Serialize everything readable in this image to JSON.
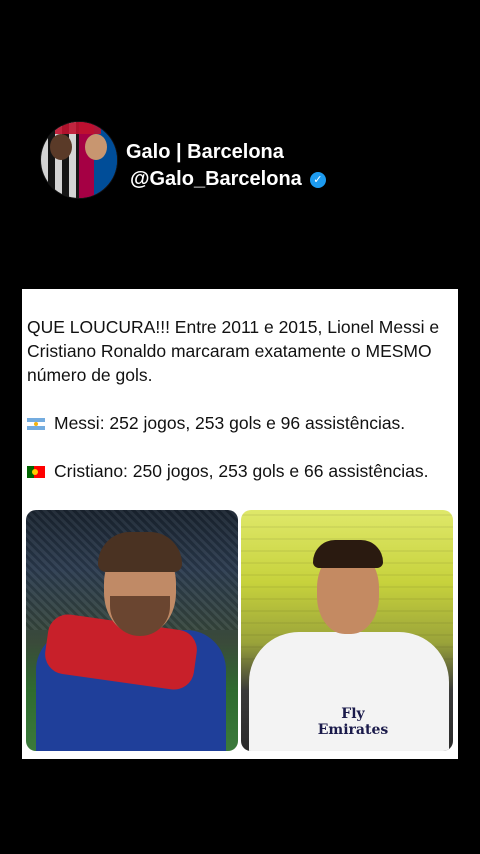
{
  "profile": {
    "name": "Galo | Barcelona",
    "handle": "@Galo_Barcelona",
    "verified_icon": "verified-badge-icon",
    "verified_color": "#1d9bf0"
  },
  "tweet": {
    "line1": "QUE LOUCURA!!! Entre 2011 e 2015, Lionel Messi e",
    "line2": "Cristiano Ronaldo marcaram exatamente o MESMO",
    "line3": "número de gols.",
    "messi_stats": "Messi: 252 jogos, 253 gols e 96 assistências.",
    "cristiano_stats": "Cristiano: 250 jogos, 253 gols e 66 assistências."
  },
  "images": {
    "right_sponsor": "Fly\nEmirates"
  }
}
